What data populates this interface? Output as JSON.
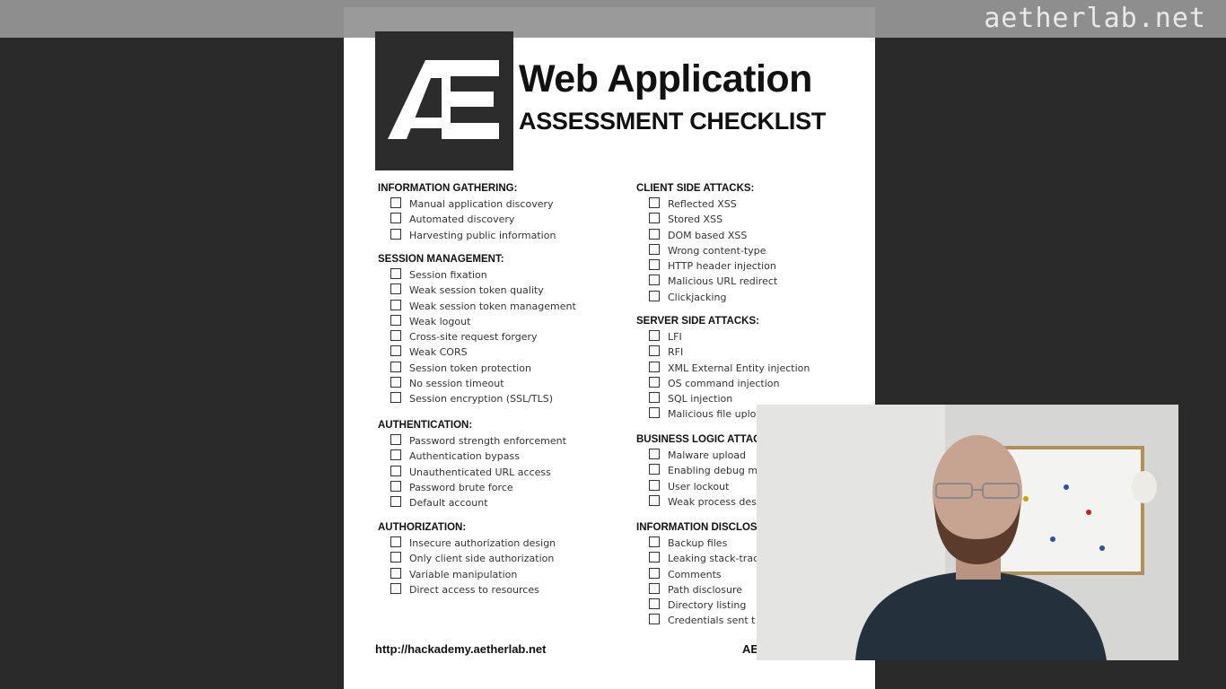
{
  "watermark": "aetherlab.net",
  "header": {
    "logo_text": "ÆE",
    "title": "Web Application",
    "subtitle": "ASSESSMENT CHECKLIST"
  },
  "sections": {
    "info_gathering": {
      "title": "INFORMATION GATHERING:",
      "items": [
        "Manual application discovery",
        "Automated discovery",
        "Harvesting public information"
      ]
    },
    "session_mgmt": {
      "title": "SESSION MANAGEMENT:",
      "items": [
        "Session fixation",
        "Weak session token quality",
        "Weak session token management",
        "Weak logout",
        "Cross-site request forgery",
        "Weak CORS",
        "Session token protection",
        "No session timeout",
        "Session encryption (SSL/TLS)"
      ]
    },
    "authentication": {
      "title": "AUTHENTICATION:",
      "items": [
        "Password strength enforcement",
        "Authentication bypass",
        "Unauthenticated URL access",
        "Password brute force",
        "Default account"
      ]
    },
    "authorization": {
      "title": "AUTHORIZATION:",
      "items": [
        "Insecure authorization design",
        "Only client side authorization",
        "Variable manipulation",
        "Direct access to resources"
      ]
    },
    "client_side": {
      "title": "CLIENT SIDE ATTACKS:",
      "items": [
        "Reflected XSS",
        "Stored XSS",
        "DOM based XSS",
        "Wrong content-type",
        "HTTP header injection",
        "Malicious URL redirect",
        "Clickjacking"
      ]
    },
    "server_side": {
      "title": "SERVER SIDE ATTACKS:",
      "items": [
        "LFI",
        "RFI",
        "XML External Entity injection",
        "OS command injection",
        "SQL injection",
        "Malicious file uploa"
      ]
    },
    "business_logic": {
      "title": "BUSINESS LOGIC ATTAC",
      "items": [
        "Malware upload",
        "Enabling debug m",
        "User lockout",
        "Weak process des"
      ]
    },
    "info_disclosure": {
      "title": "INFORMATION DISCLOS",
      "items": [
        "Backup files",
        "Leaking stack-trac",
        "Comments",
        "Path disclosure",
        "Directory listing",
        "Credentials sent t"
      ]
    }
  },
  "footer": {
    "url": "http://hackademy.aetherlab.net",
    "right_text": "AE"
  },
  "colors": {
    "background": "#2a2a2a",
    "topbar": "#8e8e8e",
    "sheet": "#ffffff",
    "logo_bg": "#2c2c2c"
  }
}
